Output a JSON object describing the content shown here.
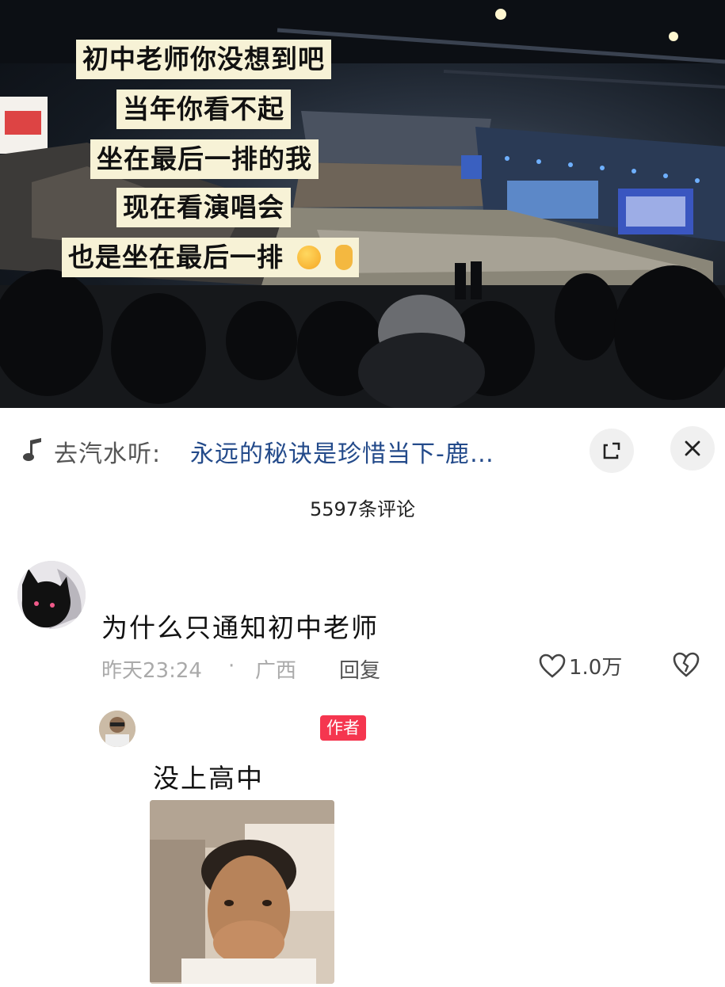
{
  "photo": {
    "captions": [
      "初中老师你没想到吧",
      "当年你看不起",
      "坐在最后一排的我",
      "现在看演唱会",
      "也是坐在最后一排"
    ],
    "emoji_icons": [
      "smiling-face-with-hearts-icon",
      "ok-hand-icon"
    ]
  },
  "music_bar": {
    "prefix": "去汽水听:",
    "song": "永远的秘诀是珍惜当下-鹿…",
    "icons": [
      "music-note-icon",
      "expand-icon",
      "close-icon"
    ]
  },
  "comments_header": {
    "count_label": "5597条评论"
  },
  "comment": {
    "text": "为什么只通知初中老师",
    "time": "昨天23:24",
    "separator": "·",
    "location": "广西",
    "reply_label": "回复",
    "like_count": "1.0万"
  },
  "reply": {
    "author_badge": "作者",
    "text": "没上高中"
  },
  "colors": {
    "caption_bg": "#f7f2d6",
    "song_link": "#234a8a",
    "author_badge": "#f5364f",
    "meta_text": "#aaaaaa"
  }
}
